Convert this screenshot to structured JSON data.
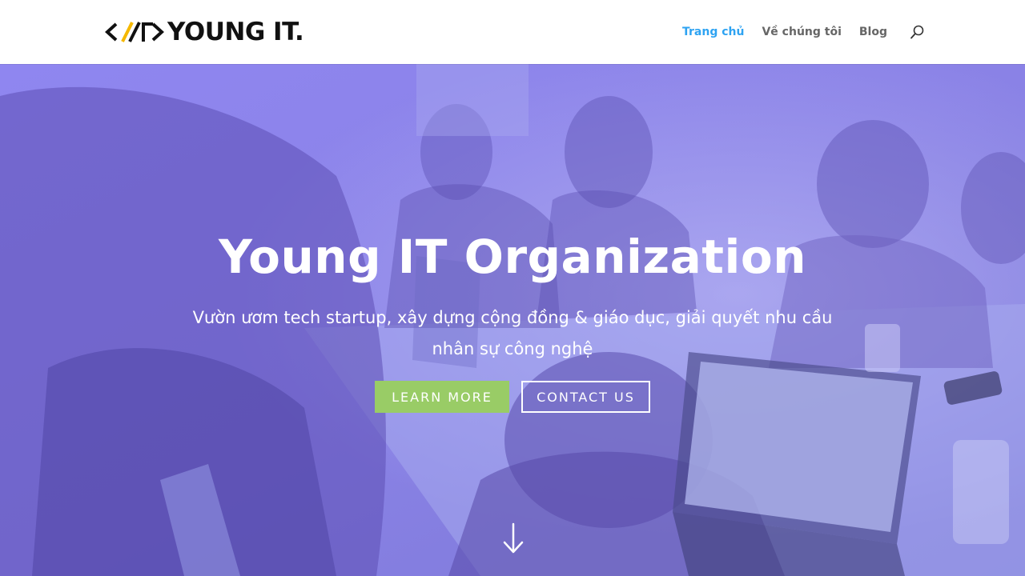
{
  "header": {
    "logo_text": "YOUNG IT.",
    "nav": [
      {
        "label": "Trang chủ",
        "active": true
      },
      {
        "label": "Về chúng tôi",
        "active": false
      },
      {
        "label": "Blog",
        "active": false
      }
    ],
    "search_icon": "search-icon"
  },
  "hero": {
    "title": "Young IT Organization",
    "subtitle": "Vườn ươm tech startup, xây dựng cộng đồng & giáo dục, giải quyết nhu cầu nhân sự công nghệ",
    "buttons": {
      "primary_label": "LEARN MORE",
      "secondary_label": "CONTACT US"
    },
    "scroll_icon": "arrow-down-icon"
  },
  "colors": {
    "nav_active": "#2ea3f2",
    "nav_text": "#666666",
    "primary_button": "#99cc66",
    "hero_overlay": "#8579e8",
    "logo_accent": "#f5b800"
  }
}
